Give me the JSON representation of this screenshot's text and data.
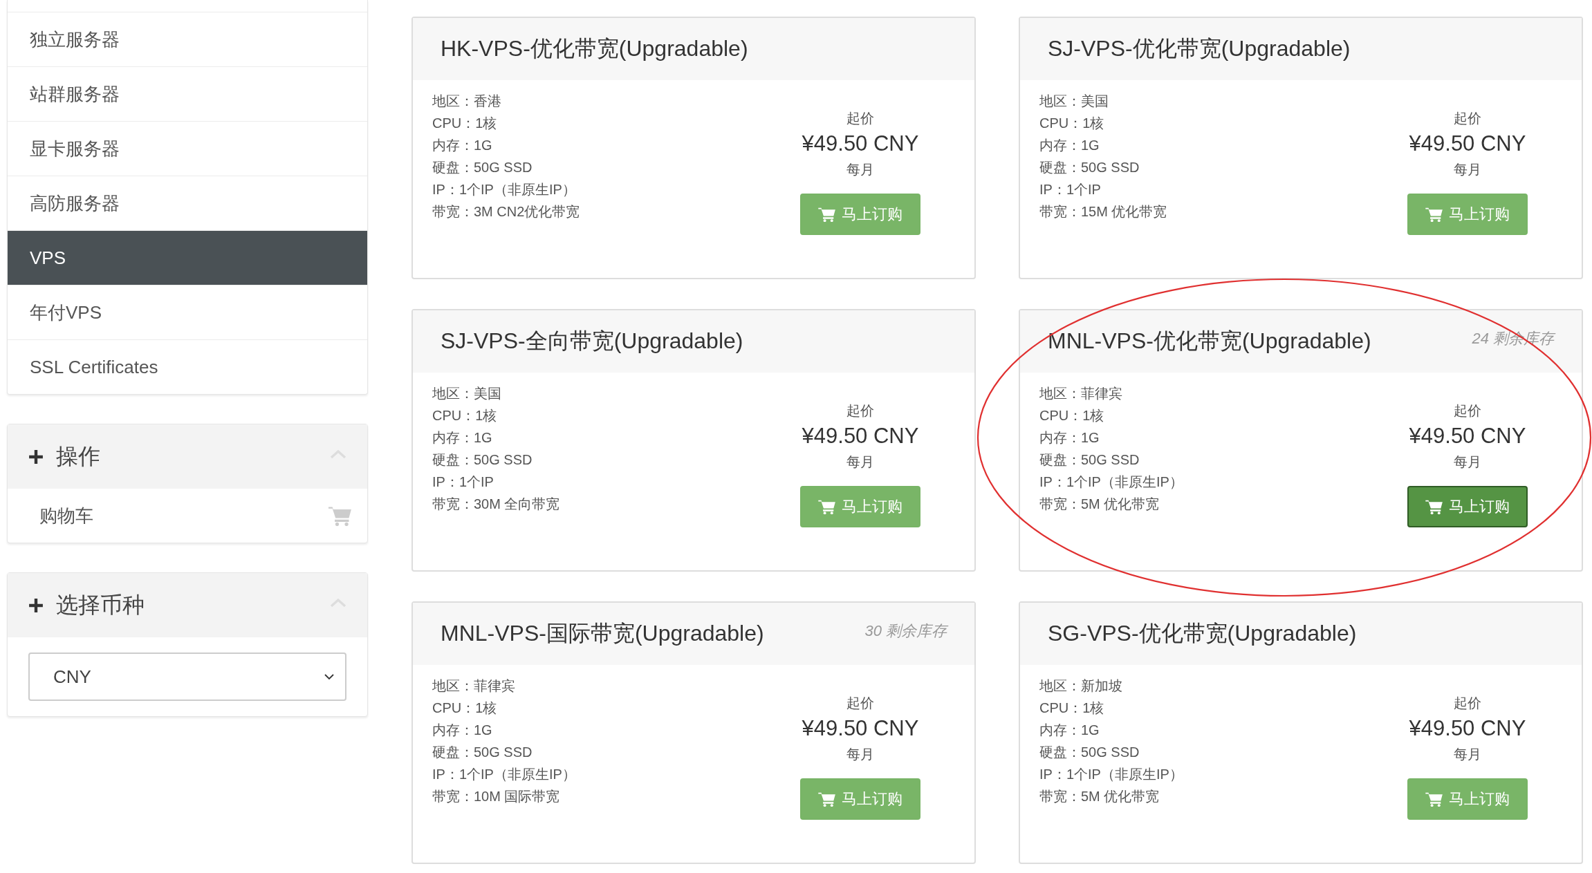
{
  "sidebar": {
    "items": [
      {
        "label": "独立服务器",
        "selected": false
      },
      {
        "label": "站群服务器",
        "selected": false
      },
      {
        "label": "显卡服务器",
        "selected": false
      },
      {
        "label": "高防服务器",
        "selected": false
      },
      {
        "label": "VPS",
        "selected": true
      },
      {
        "label": "年付VPS",
        "selected": false
      },
      {
        "label": "SSL Certificates",
        "selected": false
      }
    ],
    "actions": {
      "title": "操作",
      "items": [
        {
          "label": "购物车"
        }
      ]
    },
    "currency": {
      "title": "选择币种",
      "value": "CNY"
    }
  },
  "products": [
    {
      "title": "HK-VPS-优化带宽(Upgradable)",
      "specs": [
        "地区：香港",
        "CPU：1核",
        "内存：1G",
        "硬盘：50G SSD",
        "IP：1个IP（非原生IP）",
        "带宽：3M CN2优化带宽"
      ],
      "price_label": "起价",
      "price": "¥49.50 CNY",
      "period": "每月",
      "button": {
        "label": "马上订购",
        "hover": false
      },
      "circled": false
    },
    {
      "title": "SJ-VPS-优化带宽(Upgradable)",
      "specs": [
        "地区：美国",
        "CPU：1核",
        "内存：1G",
        "硬盘：50G SSD",
        "IP：1个IP",
        "带宽：15M 优化带宽"
      ],
      "price_label": "起价",
      "price": "¥49.50 CNY",
      "period": "每月",
      "button": {
        "label": "马上订购",
        "hover": false
      },
      "circled": false
    },
    {
      "title": "SJ-VPS-全向带宽(Upgradable)",
      "specs": [
        "地区：美国",
        "CPU：1核",
        "内存：1G",
        "硬盘：50G SSD",
        "IP：1个IP",
        "带宽：30M 全向带宽"
      ],
      "price_label": "起价",
      "price": "¥49.50 CNY",
      "period": "每月",
      "button": {
        "label": "马上订购",
        "hover": false
      },
      "circled": false
    },
    {
      "title": "MNL-VPS-优化带宽(Upgradable)",
      "stock": "24 剩余库存",
      "specs": [
        "地区：菲律宾",
        "CPU：1核",
        "内存：1G",
        "硬盘：50G SSD",
        "IP：1个IP（非原生IP）",
        "带宽：5M 优化带宽"
      ],
      "price_label": "起价",
      "price": "¥49.50 CNY",
      "period": "每月",
      "button": {
        "label": "马上订购",
        "hover": true
      },
      "circled": true
    },
    {
      "title": "MNL-VPS-国际带宽(Upgradable)",
      "stock": "30 剩余库存",
      "specs": [
        "地区：菲律宾",
        "CPU：1核",
        "内存：1G",
        "硬盘：50G SSD",
        "IP：1个IP（非原生IP）",
        "带宽：10M 国际带宽"
      ],
      "price_label": "起价",
      "price": "¥49.50 CNY",
      "period": "每月",
      "button": {
        "label": "马上订购",
        "hover": false
      },
      "circled": false
    },
    {
      "title": "SG-VPS-优化带宽(Upgradable)",
      "specs": [
        "地区：新加坡",
        "CPU：1核",
        "内存：1G",
        "硬盘：50G SSD",
        "IP：1个IP（非原生IP）",
        "带宽：5M 优化带宽"
      ],
      "price_label": "起价",
      "price": "¥49.50 CNY",
      "period": "每月",
      "button": {
        "label": "马上订购",
        "hover": false
      },
      "circled": false
    }
  ]
}
